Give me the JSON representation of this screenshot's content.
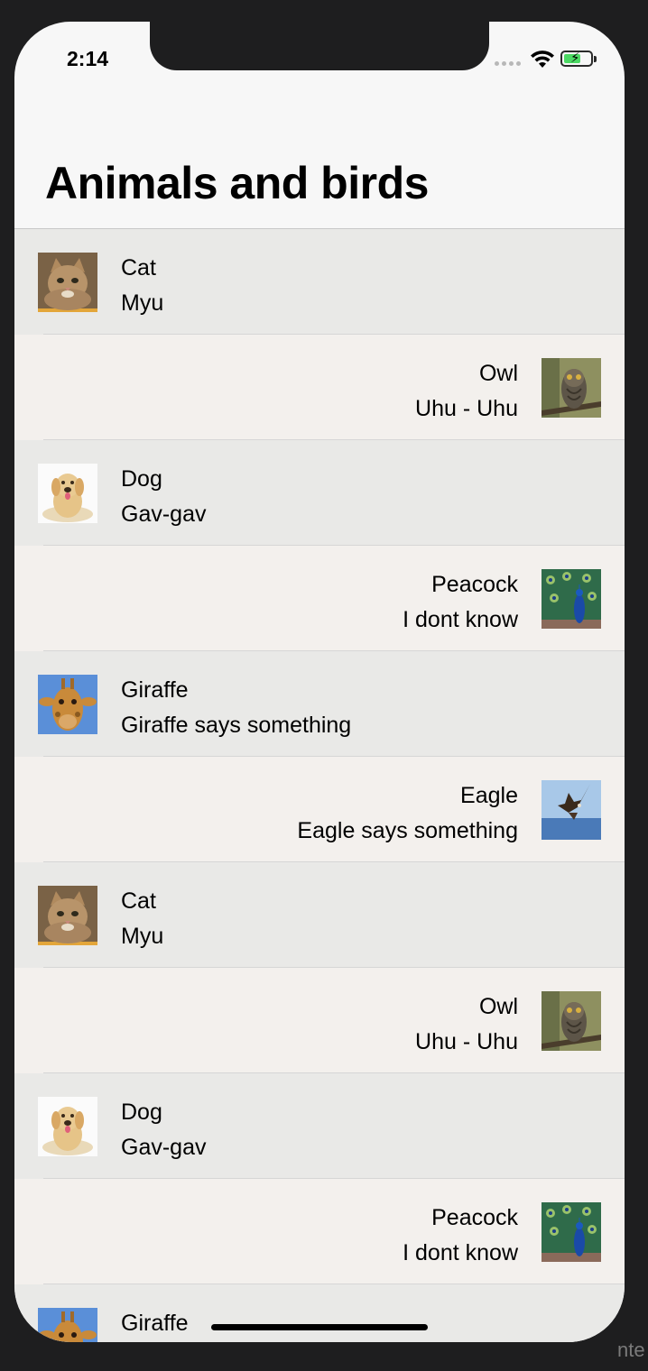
{
  "status_bar": {
    "time": "2:14"
  },
  "nav": {
    "title": "Animals and birds"
  },
  "rows": [
    {
      "name": "Cat",
      "sound": "Myu",
      "align": "left",
      "image": "cat"
    },
    {
      "name": "Owl",
      "sound": "Uhu - Uhu",
      "align": "right",
      "image": "owl"
    },
    {
      "name": "Dog",
      "sound": "Gav-gav",
      "align": "left",
      "image": "dog"
    },
    {
      "name": "Peacock",
      "sound": "I dont know",
      "align": "right",
      "image": "peacock"
    },
    {
      "name": "Giraffe",
      "sound": "Giraffe says something",
      "align": "left",
      "image": "giraffe"
    },
    {
      "name": "Eagle",
      "sound": "Eagle says something",
      "align": "right",
      "image": "eagle"
    },
    {
      "name": "Cat",
      "sound": "Myu",
      "align": "left",
      "image": "cat"
    },
    {
      "name": "Owl",
      "sound": "Uhu - Uhu",
      "align": "right",
      "image": "owl"
    },
    {
      "name": "Dog",
      "sound": "Gav-gav",
      "align": "left",
      "image": "dog"
    },
    {
      "name": "Peacock",
      "sound": "I dont know",
      "align": "right",
      "image": "peacock"
    },
    {
      "name": "Giraffe",
      "sound": "",
      "align": "left",
      "image": "giraffe"
    }
  ],
  "corner": {
    "text": "nte"
  },
  "colors": {
    "row_left_bg": "#e9e9e7",
    "row_right_bg": "#f3f0ed",
    "battery_green": "#4cd964"
  }
}
